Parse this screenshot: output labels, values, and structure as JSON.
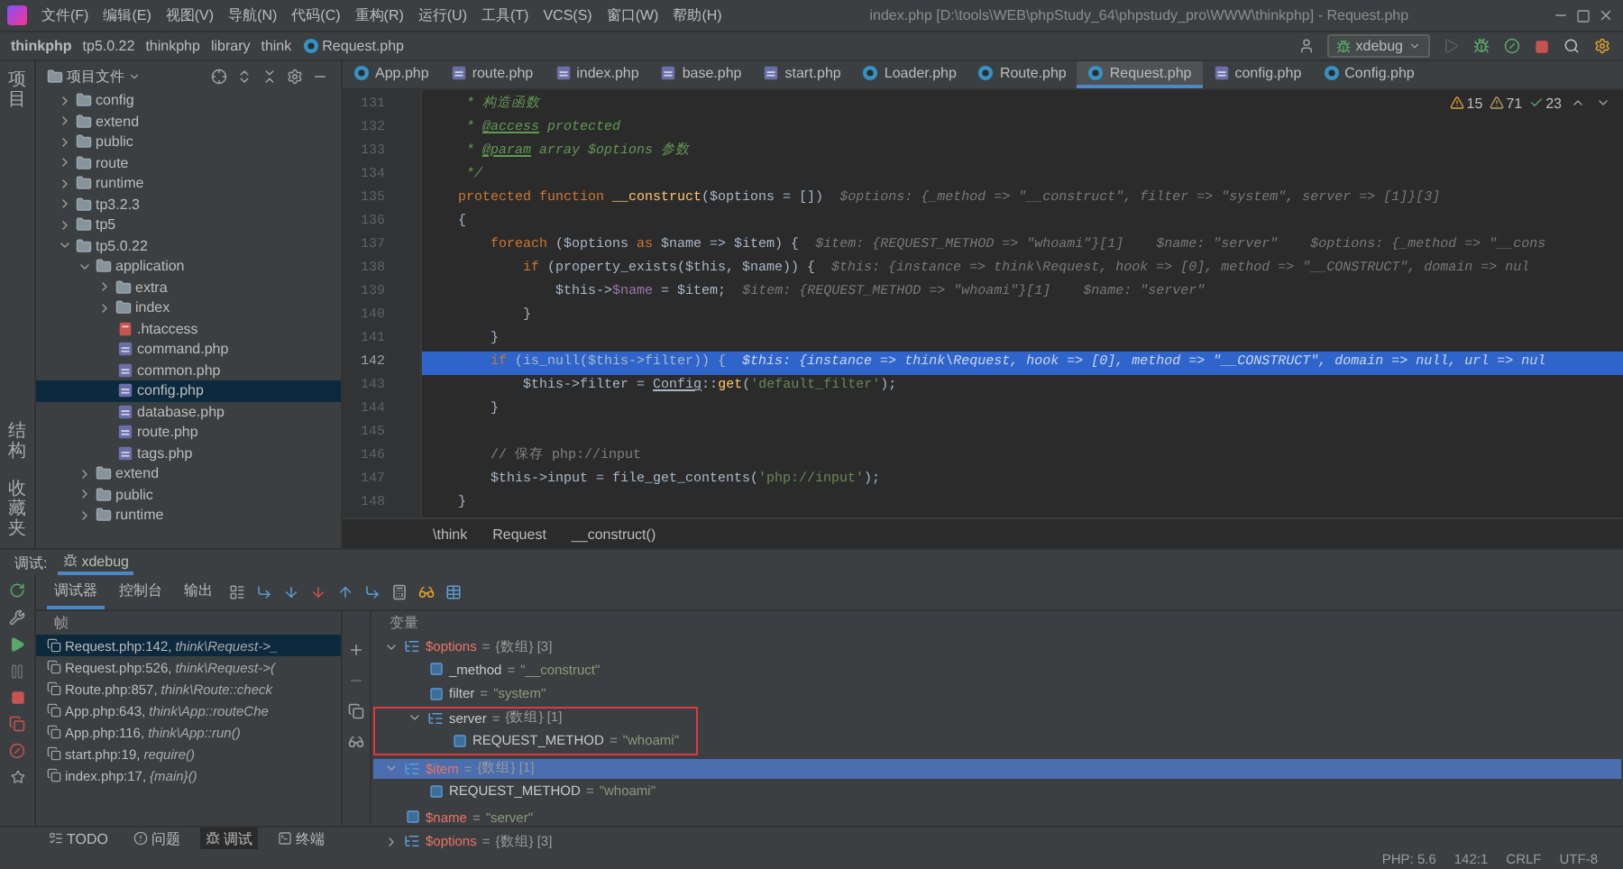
{
  "window": {
    "title": "index.php [D:\\tools\\WEB\\phpStudy_64\\phpstudy_pro\\WWW\\thinkphp] - Request.php"
  },
  "menu": [
    "文件(F)",
    "编辑(E)",
    "视图(V)",
    "导航(N)",
    "代码(C)",
    "重构(R)",
    "运行(U)",
    "工具(T)",
    "VCS(S)",
    "窗口(W)",
    "帮助(H)"
  ],
  "breadcrumb": [
    {
      "label": "thinkphp",
      "kind": "project"
    },
    {
      "label": "tp5.0.22",
      "kind": "folder"
    },
    {
      "label": "thinkphp",
      "kind": "folder"
    },
    {
      "label": "library",
      "kind": "folder"
    },
    {
      "label": "think",
      "kind": "folder"
    },
    {
      "label": "Request.php",
      "kind": "file"
    }
  ],
  "run_config": {
    "label": "xdebug"
  },
  "side_labels": {
    "top": [
      "项目"
    ],
    "bottom": [
      "结构",
      "收藏夹"
    ]
  },
  "project": {
    "title": "项目文件",
    "tree": [
      {
        "label": "config",
        "kind": "folder",
        "expanded": false,
        "selected": false
      },
      {
        "label": "extend",
        "kind": "folder",
        "expanded": false,
        "selected": false
      },
      {
        "label": "public",
        "kind": "folder",
        "expanded": false,
        "selected": false
      },
      {
        "label": "route",
        "kind": "folder",
        "expanded": false,
        "selected": false
      },
      {
        "label": "runtime",
        "kind": "folder",
        "expanded": false,
        "selected": false
      },
      {
        "label": "tp3.2.3",
        "kind": "folder",
        "expanded": false,
        "selected": false
      },
      {
        "label": "tp5",
        "kind": "folder",
        "expanded": false,
        "selected": false
      },
      {
        "label": "tp5.0.22",
        "kind": "folder",
        "expanded": true,
        "selected": false,
        "children": [
          {
            "label": "application",
            "kind": "folder",
            "expanded": true,
            "selected": false,
            "children": [
              {
                "label": "extra",
                "kind": "folder",
                "expanded": false,
                "selected": false
              },
              {
                "label": "index",
                "kind": "folder",
                "expanded": false,
                "selected": false
              },
              {
                "label": ".htaccess",
                "kind": "htaccess",
                "selected": false
              },
              {
                "label": "command.php",
                "kind": "php",
                "selected": false
              },
              {
                "label": "common.php",
                "kind": "php",
                "selected": false
              },
              {
                "label": "config.php",
                "kind": "php",
                "selected": true
              },
              {
                "label": "database.php",
                "kind": "php",
                "selected": false
              },
              {
                "label": "route.php",
                "kind": "php",
                "selected": false
              },
              {
                "label": "tags.php",
                "kind": "php",
                "selected": false
              }
            ]
          },
          {
            "label": "extend",
            "kind": "folder",
            "expanded": false,
            "selected": false
          },
          {
            "label": "public",
            "kind": "folder",
            "expanded": false,
            "selected": false
          },
          {
            "label": "runtime",
            "kind": "folder",
            "expanded": false,
            "selected": false
          }
        ]
      }
    ]
  },
  "editor": {
    "tabs": [
      {
        "label": "App.php",
        "kind": "class",
        "selected": false
      },
      {
        "label": "route.php",
        "kind": "script",
        "selected": false
      },
      {
        "label": "index.php",
        "kind": "script",
        "selected": false
      },
      {
        "label": "base.php",
        "kind": "script",
        "selected": false
      },
      {
        "label": "start.php",
        "kind": "script",
        "selected": false
      },
      {
        "label": "Loader.php",
        "kind": "class",
        "selected": false
      },
      {
        "label": "Route.php",
        "kind": "class",
        "selected": false
      },
      {
        "label": "Request.php",
        "kind": "class",
        "selected": true
      },
      {
        "label": "config.php",
        "kind": "script",
        "selected": false
      },
      {
        "label": "Config.php",
        "kind": "class",
        "selected": false
      }
    ],
    "inspections": {
      "warnings": "15",
      "weak_warnings": "71",
      "ok": "23"
    },
    "lines": [
      {
        "number": "131",
        "current": false,
        "segments": [
          {
            "kind": "doc",
            "text": "     * 构造函数"
          }
        ]
      },
      {
        "number": "132",
        "current": false,
        "segments": [
          {
            "kind": "doc",
            "text": "     * "
          },
          {
            "kind": "tag",
            "text": "@access"
          },
          {
            "kind": "doc",
            "text": " protected"
          }
        ]
      },
      {
        "number": "133",
        "current": false,
        "segments": [
          {
            "kind": "doc",
            "text": "     * "
          },
          {
            "kind": "tag",
            "text": "@param"
          },
          {
            "kind": "doc",
            "text": " array $options 参数"
          }
        ]
      },
      {
        "number": "134",
        "current": false,
        "segments": [
          {
            "kind": "doc",
            "text": "     */"
          }
        ]
      },
      {
        "number": "135",
        "current": false,
        "segments": [
          {
            "kind": "kw",
            "text": "    protected function "
          },
          {
            "kind": "fn",
            "text": "__construct"
          },
          {
            "kind": "plain",
            "text": "($options = [])"
          },
          {
            "kind": "hint",
            "text": "  $options: {_method => \"__construct\", filter => \"system\", server => [1]}[3]"
          }
        ]
      },
      {
        "number": "136",
        "current": false,
        "segments": [
          {
            "kind": "plain",
            "text": "    {"
          }
        ]
      },
      {
        "number": "137",
        "current": false,
        "segments": [
          {
            "kind": "kw",
            "text": "        foreach"
          },
          {
            "kind": "plain",
            "text": " ($options "
          },
          {
            "kind": "kw",
            "text": "as"
          },
          {
            "kind": "plain",
            "text": " $name => $item) {"
          },
          {
            "kind": "hint",
            "text": "  $item: {REQUEST_METHOD => \"whoami\"}[1]    $name: \"server\"    $options: {_method => \"__cons"
          }
        ]
      },
      {
        "number": "138",
        "current": false,
        "segments": [
          {
            "kind": "kw",
            "text": "            if"
          },
          {
            "kind": "plain",
            "text": " (property_exists($this, $name)) {"
          },
          {
            "kind": "hint",
            "text": "  $this: {instance => think\\Request, hook => [0], method => \"__CONSTRUCT\", domain => nul"
          }
        ]
      },
      {
        "number": "139",
        "current": false,
        "segments": [
          {
            "kind": "plain",
            "text": "                $this->"
          },
          {
            "kind": "var",
            "text": "$name"
          },
          {
            "kind": "plain",
            "text": " = $item;"
          },
          {
            "kind": "hint",
            "text": "  $item: {REQUEST_METHOD => \"whoami\"}[1]    $name: \"server\""
          }
        ]
      },
      {
        "number": "140",
        "current": false,
        "segments": [
          {
            "kind": "plain",
            "text": "            }"
          }
        ]
      },
      {
        "number": "141",
        "current": false,
        "segments": [
          {
            "kind": "plain",
            "text": "        }"
          }
        ]
      },
      {
        "number": "142",
        "current": true,
        "segments": [
          {
            "kind": "kw",
            "text": "        if"
          },
          {
            "kind": "plain",
            "text": " (is_null($this->filter)) {"
          },
          {
            "kind": "hint",
            "text": "  $this: {instance => think\\Request, hook => [0], method => \"__CONSTRUCT\", domain => null, url => nul"
          }
        ]
      },
      {
        "number": "143",
        "current": false,
        "segments": [
          {
            "kind": "plain",
            "text": "            $this->filter = "
          },
          {
            "kind": "cls",
            "text": "Config"
          },
          {
            "kind": "plain",
            "text": "::"
          },
          {
            "kind": "fn",
            "text": "get"
          },
          {
            "kind": "plain",
            "text": "("
          },
          {
            "kind": "str",
            "text": "'default_filter'"
          },
          {
            "kind": "plain",
            "text": ");"
          }
        ]
      },
      {
        "number": "144",
        "current": false,
        "segments": [
          {
            "kind": "plain",
            "text": "        }"
          }
        ]
      },
      {
        "number": "145",
        "current": false
      },
      {
        "number": "146",
        "current": false,
        "segments": [
          {
            "kind": "com",
            "text": "        // 保存 php://input"
          }
        ]
      },
      {
        "number": "147",
        "current": false,
        "segments": [
          {
            "kind": "plain",
            "text": "        $this->input = file_get_contents("
          },
          {
            "kind": "str",
            "text": "'php://input'"
          },
          {
            "kind": "plain",
            "text": ");"
          }
        ]
      },
      {
        "number": "148",
        "current": false,
        "segments": [
          {
            "kind": "plain",
            "text": "    }"
          }
        ]
      }
    ],
    "code_breadcrumb": [
      "\\think",
      "Request",
      "__construct()"
    ]
  },
  "debug": {
    "title": "调试:",
    "session_tab": "xdebug",
    "subtabs": [
      {
        "label": "调试器",
        "selected": true
      },
      {
        "label": "控制台",
        "selected": false
      },
      {
        "label": "输出",
        "selected": false
      }
    ],
    "frames_header": "帧",
    "variables_header": "变量",
    "frames": [
      {
        "location": "Request.php:142,",
        "function": "think\\Request->_",
        "selected": true
      },
      {
        "location": "Request.php:526,",
        "function": "think\\Request->(",
        "selected": false
      },
      {
        "location": "Route.php:857,",
        "function": "think\\Route::check",
        "selected": false
      },
      {
        "location": "App.php:643,",
        "function": "think\\App::routeChe",
        "selected": false
      },
      {
        "location": "App.php:116,",
        "function": "think\\App::run()",
        "selected": false
      },
      {
        "location": "start.php:19,",
        "function": "require()",
        "selected": false
      },
      {
        "location": "index.php:17,",
        "function": "{main}()",
        "selected": false
      }
    ],
    "variables": [
      {
        "name": "$options",
        "op": "=",
        "value": "{数组} [3]",
        "kind": "array",
        "expanded": true,
        "selected": false,
        "boxed": false,
        "children": [
          {
            "name": "_method",
            "op": "=",
            "value": "\"__construct\"",
            "kind": "string",
            "selected": false,
            "boxed": false
          },
          {
            "name": "filter",
            "op": "=",
            "value": "\"system\"",
            "kind": "string",
            "selected": false,
            "boxed": false
          },
          {
            "name": "server",
            "op": "=",
            "value": "{数组} [1]",
            "kind": "array",
            "expanded": true,
            "selected": false,
            "boxed": true,
            "children": [
              {
                "name": "REQUEST_METHOD",
                "op": "=",
                "value": "\"whoami\"",
                "kind": "string",
                "selected": false,
                "boxed": false
              }
            ]
          }
        ]
      },
      {
        "name": "$item",
        "op": "=",
        "value": "{数组} [1]",
        "kind": "array",
        "expanded": true,
        "selected": true,
        "boxed": false,
        "children": [
          {
            "name": "REQUEST_METHOD",
            "op": "=",
            "value": "\"whoami\"",
            "kind": "string",
            "selected": false,
            "boxed": false
          }
        ]
      },
      {
        "name": "$name",
        "op": "=",
        "value": "\"server\"",
        "kind": "string",
        "selected": false,
        "boxed": false
      },
      {
        "name": "$options",
        "op": "=",
        "value": "{数组} [3]",
        "kind": "array",
        "expanded": false,
        "selected": false,
        "boxed": false
      }
    ]
  },
  "tool_windows": [
    {
      "label": "TODO",
      "kind": "todo",
      "selected": false
    },
    {
      "label": "问题",
      "kind": "problems",
      "selected": false
    },
    {
      "label": "调试",
      "kind": "debug",
      "selected": true
    },
    {
      "label": "终端",
      "kind": "terminal",
      "selected": false
    }
  ],
  "status_bar": [
    "PHP: 5.6",
    "142:1",
    "CRLF",
    "UTF-8"
  ]
}
